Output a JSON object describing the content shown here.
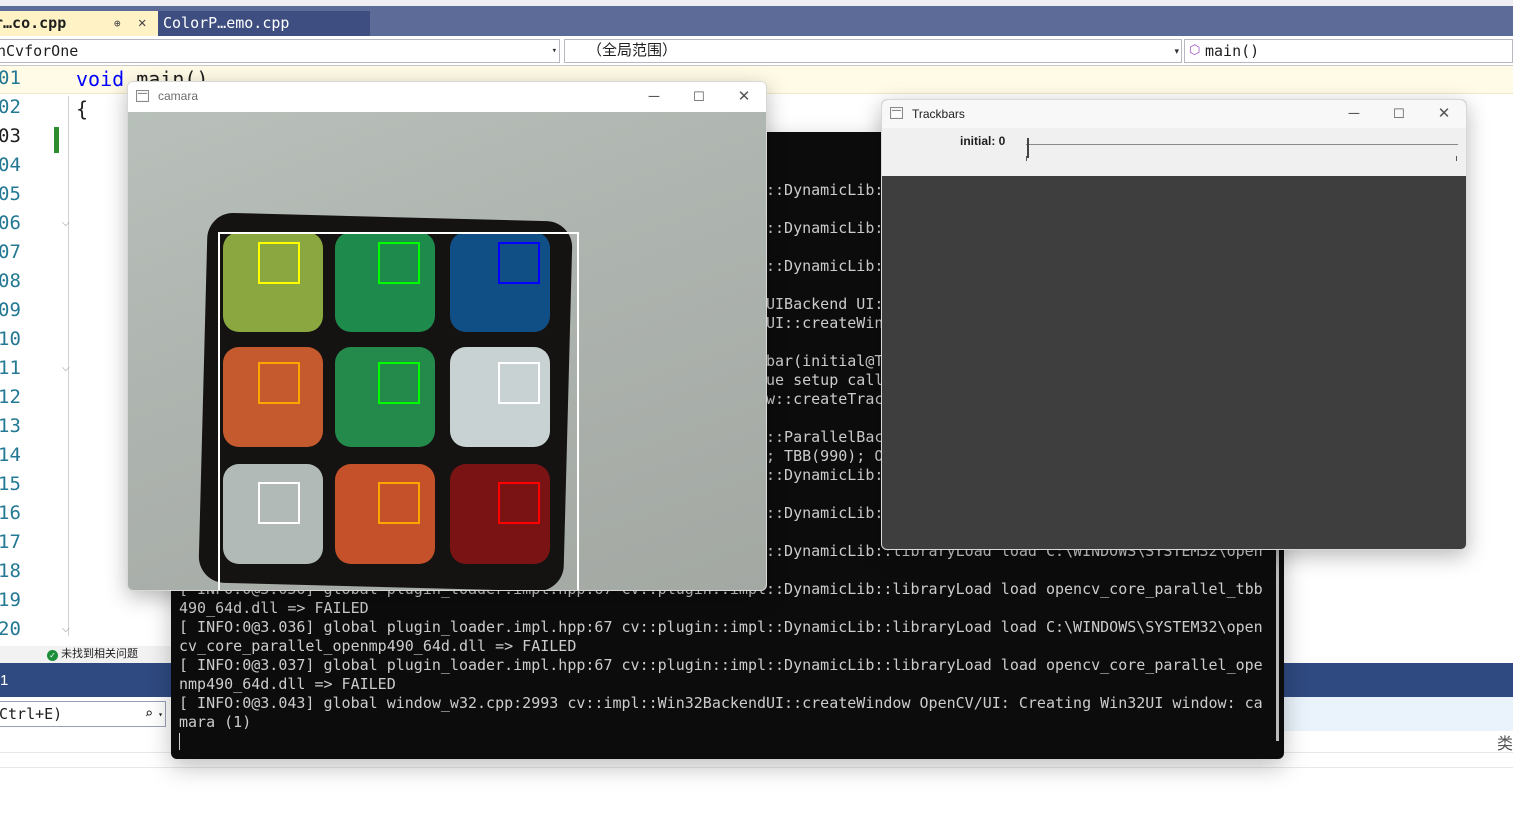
{
  "tabs": [
    {
      "label": "r…co.cpp",
      "pin": "⊕",
      "close": "✕"
    },
    {
      "label": "ColorP…emo.cpp"
    }
  ],
  "nav": {
    "project": "nCvforOne",
    "scope": "（全局范围）",
    "member": "main()"
  },
  "editor": {
    "line_numbers": [
      "01",
      "02",
      "03",
      "04",
      "05",
      "06",
      "07",
      "08",
      "09",
      "10",
      "11",
      "12",
      "13",
      "14",
      "15",
      "16",
      "17",
      "18",
      "19",
      "20"
    ],
    "code_keyword": "void",
    "code_rest": "main()",
    "brace": "{"
  },
  "status": {
    "issues": "未找到相关问题"
  },
  "output": {
    "header": "1",
    "search": "Ctrl+E)",
    "side_label": "类"
  },
  "console": {
    "lines": [
      "::DynamicLib:",
      "",
      "::DynamicLib:",
      "",
      "::DynamicLib:",
      "",
      "UIBackend UI:",
      "UI::createWin",
      "",
      "bar(initial@T",
      "ue setup call",
      "w::createTrac",
      "",
      "::ParallelBac",
      "; TBB(990); O",
      "::DynamicLib:",
      "",
      "::DynamicLib:",
      "",
      "::DynamicLib::libraryLoad load C:\\WINDOWS\\SYSTEM32\\open",
      "",
      "[ INFO:0@3.036] global plugin_loader.impl.hpp:67 cv::plugin::impl::DynamicLib::libraryLoad load opencv_core_parallel_tbb",
      "490_64d.dll => FAILED",
      "[ INFO:0@3.036] global plugin_loader.impl.hpp:67 cv::plugin::impl::DynamicLib::libraryLoad load C:\\WINDOWS\\SYSTEM32\\open",
      "cv_core_parallel_openmp490_64d.dll => FAILED",
      "[ INFO:0@3.037] global plugin_loader.impl.hpp:67 cv::plugin::impl::DynamicLib::libraryLoad load opencv_core_parallel_ope",
      "nmp490_64d.dll => FAILED",
      "[ INFO:0@3.043] global window_w32.cpp:2993 cv::impl::Win32BackendUI::createWindow OpenCV/UI: Creating Win32UI window: ca",
      "mara (1)"
    ]
  },
  "camara_window": {
    "title": "camara",
    "minimize": "─",
    "maximize": "☐",
    "close": "✕"
  },
  "trackbar_window": {
    "title": "Trackbars",
    "label": "initial: 0",
    "value": 0,
    "minimize": "─",
    "maximize": "☐",
    "close": "✕"
  },
  "cube_tiles": [
    {
      "color": "#8aa83f",
      "roi": "#ffff00"
    },
    {
      "color": "#1e8a4c",
      "roi": "#00ff00"
    },
    {
      "color": "#0f4f86",
      "roi": "#0000ff"
    },
    {
      "color": "#c45a2e",
      "roi": "#ffa500"
    },
    {
      "color": "#238a4c",
      "roi": "#00ff00"
    },
    {
      "color": "#c8d2d2",
      "roi": "#ffffff"
    },
    {
      "color": "#b2bab8",
      "roi": "#ffffff"
    },
    {
      "color": "#c4512a",
      "roi": "#ffa500"
    },
    {
      "color": "#7a1414",
      "roi": "#ff0000"
    }
  ]
}
